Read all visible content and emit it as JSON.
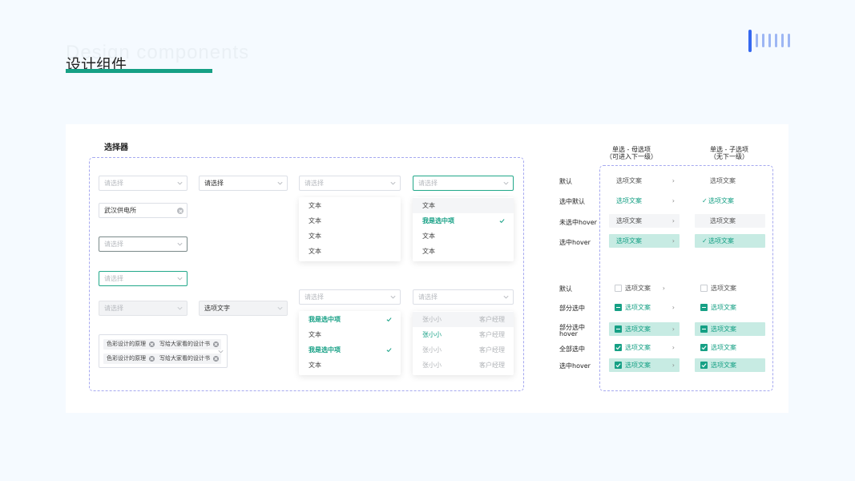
{
  "header": {
    "bg_title": "Design components",
    "title": "设计组件"
  },
  "section": {
    "title": "选择器"
  },
  "colors": {
    "accent": "#16a085",
    "border_dashed": "#a6a9f0",
    "blue_bar": "#3568f0"
  },
  "selects": {
    "s1": "请选择",
    "s2": "请选择",
    "s3": "请选择",
    "s4": "请选择",
    "clearable": "武汉供电所",
    "hover": "请选择",
    "focus": "请选择",
    "disabled": "请选择",
    "disabled_filled": "选项文字",
    "multi1": "请选择",
    "multi2": "请选择"
  },
  "panel_a": {
    "items": [
      "文本",
      "文本",
      "文本",
      "文本"
    ]
  },
  "panel_b": {
    "items": [
      "文本",
      "我是选中项",
      "文本",
      "文本"
    ]
  },
  "panel_c": {
    "items": [
      "我是选中项",
      "文本",
      "我是选中项",
      "文本"
    ]
  },
  "panel_d": {
    "rows": [
      {
        "name": "张小小",
        "role": "客户经理"
      },
      {
        "name": "张小小",
        "role": "客户经理"
      },
      {
        "name": "张小小",
        "role": "客户经理"
      },
      {
        "name": "张小小",
        "role": "客户经理"
      }
    ]
  },
  "tags": [
    "色彩设计的原理",
    "写给大家看的设计书",
    "色彩设计的原理",
    "写给大家看的设计书"
  ],
  "right": {
    "col1_line1": "单选 - 母选项",
    "col1_line2": "（可进入下一级）",
    "col2_line1": "单选 - 子选项",
    "col2_line2": "（无下一级）",
    "labels_top": [
      "默认",
      "选中默认",
      "未选中hover",
      "选中hover"
    ],
    "labels_bottom": [
      "默认",
      "部分选中",
      "部分选中",
      "hover",
      "全部选中",
      "选中hover"
    ],
    "item_text": "选项文案",
    "arrow": "›",
    "check": "✓"
  }
}
